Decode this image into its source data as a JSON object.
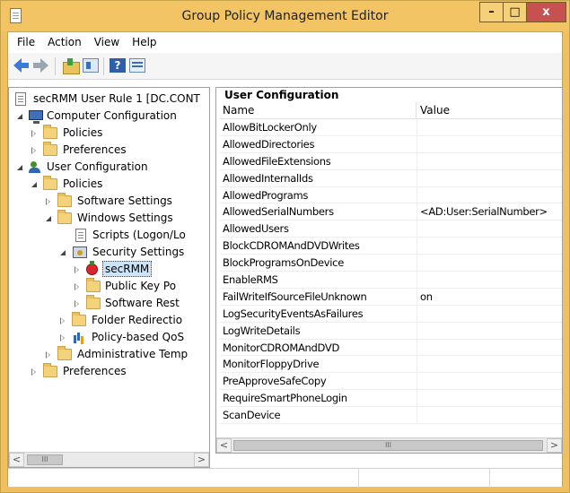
{
  "window": {
    "title": "Group Policy Management Editor",
    "min_symbol": "–",
    "max_symbol": "□",
    "close_symbol": "x"
  },
  "menu": [
    "File",
    "Action",
    "View",
    "Help"
  ],
  "toolbar": {
    "help_glyph": "?"
  },
  "tree": {
    "items": [
      {
        "label": "secRMM User Rule 1 [DC.CONT",
        "icon": "policy-doc-icon"
      },
      {
        "label": "Computer Configuration",
        "icon": "computer-icon"
      },
      {
        "label": "Policies",
        "icon": "folder-icon"
      },
      {
        "label": "Preferences",
        "icon": "folder-icon"
      },
      {
        "label": "User Configuration",
        "icon": "users-icon"
      },
      {
        "label": "Policies",
        "icon": "folder-icon"
      },
      {
        "label": "Software Settings",
        "icon": "folder-icon"
      },
      {
        "label": "Windows Settings",
        "icon": "folder-icon"
      },
      {
        "label": "Scripts (Logon/Lo",
        "icon": "script-doc-icon"
      },
      {
        "label": "Security Settings",
        "icon": "security-settings-icon"
      },
      {
        "label": "secRMM",
        "icon": "secrmm-icon"
      },
      {
        "label": "Public Key Po",
        "icon": "folder-icon"
      },
      {
        "label": "Software Rest",
        "icon": "folder-icon"
      },
      {
        "label": "Folder Redirectio",
        "icon": "folder-icon"
      },
      {
        "label": "Policy-based QoS",
        "icon": "chart-icon"
      },
      {
        "label": "Administrative Temp",
        "icon": "folder-icon"
      },
      {
        "label": "Preferences",
        "icon": "folder-icon"
      }
    ],
    "scroll_left": "<",
    "scroll_thumb": "III",
    "scroll_right": ">"
  },
  "detail": {
    "heading": "User Configuration",
    "columns": {
      "name": "Name",
      "value": "Value"
    },
    "rows": [
      {
        "name": "AllowBitLockerOnly",
        "value": ""
      },
      {
        "name": "AllowedDirectories",
        "value": ""
      },
      {
        "name": "AllowedFileExtensions",
        "value": ""
      },
      {
        "name": "AllowedInternalIds",
        "value": ""
      },
      {
        "name": "AllowedPrograms",
        "value": ""
      },
      {
        "name": "AllowedSerialNumbers",
        "value": "<AD:User:SerialNumber>"
      },
      {
        "name": "AllowedUsers",
        "value": ""
      },
      {
        "name": "BlockCDROMAndDVDWrites",
        "value": ""
      },
      {
        "name": "BlockProgramsOnDevice",
        "value": ""
      },
      {
        "name": "EnableRMS",
        "value": ""
      },
      {
        "name": "FailWriteIfSourceFileUnknown",
        "value": "on"
      },
      {
        "name": "LogSecurityEventsAsFailures",
        "value": ""
      },
      {
        "name": "LogWriteDetails",
        "value": ""
      },
      {
        "name": "MonitorCDROMAndDVD",
        "value": ""
      },
      {
        "name": "MonitorFloppyDrive",
        "value": ""
      },
      {
        "name": "PreApproveSafeCopy",
        "value": ""
      },
      {
        "name": "RequireSmartPhoneLogin",
        "value": ""
      },
      {
        "name": "ScanDevice",
        "value": ""
      }
    ],
    "scroll_left": "<",
    "scroll_thumb": "III",
    "scroll_right": ">"
  }
}
